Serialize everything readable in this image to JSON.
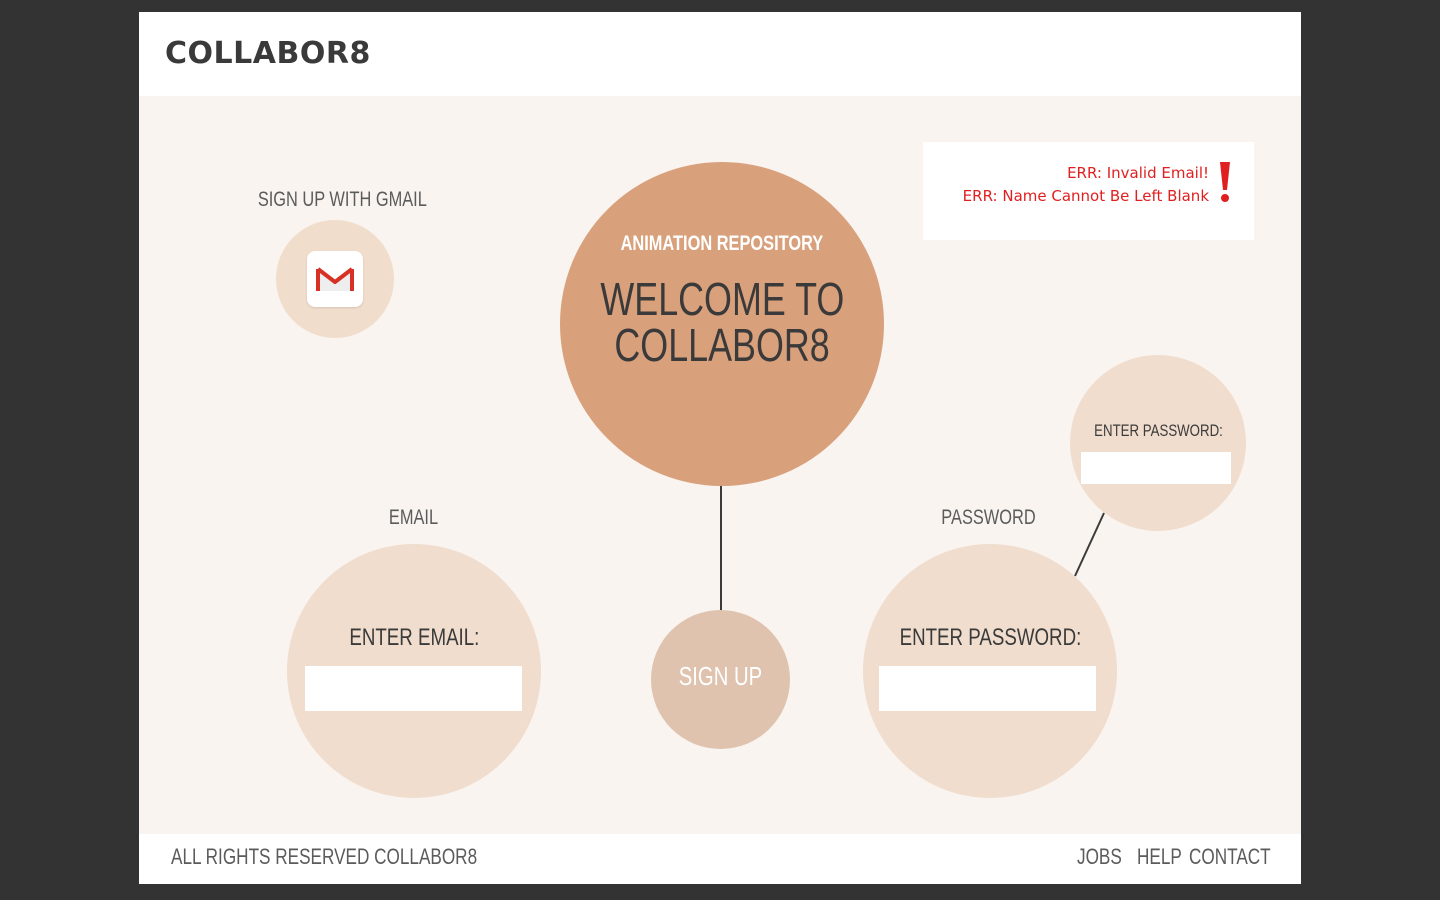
{
  "header": {
    "brand": "COLLABOR8"
  },
  "gmail": {
    "label": "SIGN UP WITH GMAIL",
    "icon": "gmail-icon",
    "icon_letter": "M"
  },
  "hero": {
    "kicker": "ANIMATION REPOSITORY",
    "title_line1": "WELCOME TO",
    "title_line2": "COLLABOR8"
  },
  "signup": {
    "label": "SIGN UP"
  },
  "email": {
    "section_label": "EMAIL",
    "prompt": "ENTER EMAIL:",
    "value": "",
    "placeholder": ""
  },
  "password": {
    "section_label": "PASSWORD",
    "prompt": "ENTER PASSWORD:",
    "value": "",
    "placeholder": ""
  },
  "password_confirm": {
    "prompt": "ENTER PASSWORD:",
    "value": "",
    "placeholder": ""
  },
  "errors": {
    "messages": [
      "ERR: Invalid Email!",
      "ERR: Name Cannot Be Left Blank"
    ],
    "icon": "exclamation-icon"
  },
  "footer": {
    "copyright": "ALL RIGHTS RESERVED COLLABOR8",
    "links": [
      "JOBS",
      "HELP",
      "CONTACT"
    ]
  },
  "colors": {
    "page_bg": "#333333",
    "content_bg": "#f9f4ef",
    "hero_circle": "#d9a07c",
    "signup_circle": "#dfc3af",
    "input_circle": "#f0ddcd",
    "error_text": "#e02020",
    "gmail_red": "#d93025",
    "dark_text": "#3a3a3a"
  }
}
